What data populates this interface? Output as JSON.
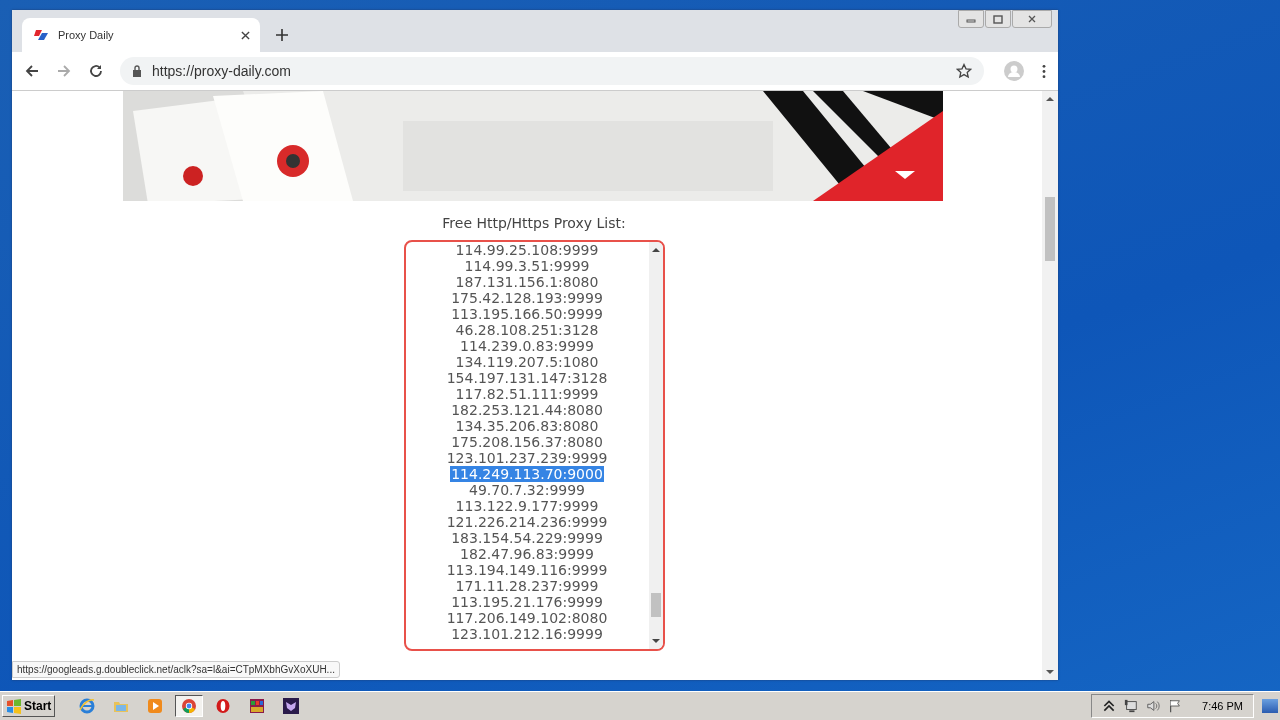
{
  "browser": {
    "tab_title": "Proxy Daily",
    "url": "https://proxy-daily.com",
    "status_url": "https://googleads.g.doubleclick.net/aclk?sa=l&ai=CTpMXbhGvXoXUH..."
  },
  "page": {
    "heading": "Free Http/Https Proxy List:",
    "proxies": [
      {
        "text": "114.99.25.108:9999",
        "selected": false
      },
      {
        "text": "114.99.3.51:9999",
        "selected": false
      },
      {
        "text": "187.131.156.1:8080",
        "selected": false
      },
      {
        "text": "175.42.128.193:9999",
        "selected": false
      },
      {
        "text": "113.195.166.50:9999",
        "selected": false
      },
      {
        "text": "46.28.108.251:3128",
        "selected": false
      },
      {
        "text": "114.239.0.83:9999",
        "selected": false
      },
      {
        "text": "134.119.207.5:1080",
        "selected": false
      },
      {
        "text": "154.197.131.147:3128",
        "selected": false
      },
      {
        "text": "117.82.51.111:9999",
        "selected": false
      },
      {
        "text": "182.253.121.44:8080",
        "selected": false
      },
      {
        "text": "134.35.206.83:8080",
        "selected": false
      },
      {
        "text": "175.208.156.37:8080",
        "selected": false
      },
      {
        "text": "123.101.237.239:9999",
        "selected": false
      },
      {
        "text": "114.249.113.70:9000",
        "selected": true
      },
      {
        "text": "49.70.7.32:9999",
        "selected": false
      },
      {
        "text": "113.122.9.177:9999",
        "selected": false
      },
      {
        "text": "121.226.214.236:9999",
        "selected": false
      },
      {
        "text": "183.154.54.229:9999",
        "selected": false
      },
      {
        "text": "182.47.96.83:9999",
        "selected": false
      },
      {
        "text": "113.194.149.116:9999",
        "selected": false
      },
      {
        "text": "171.11.28.237:9999",
        "selected": false
      },
      {
        "text": "113.195.21.176:9999",
        "selected": false
      },
      {
        "text": "117.206.149.102:8080",
        "selected": false
      },
      {
        "text": "123.101.212.16:9999",
        "selected": false
      }
    ]
  },
  "taskbar": {
    "start": "Start",
    "apps": [
      {
        "kind": "ie",
        "selected": false
      },
      {
        "kind": "folder",
        "selected": false
      },
      {
        "kind": "media",
        "selected": false
      },
      {
        "kind": "chrome",
        "selected": true
      },
      {
        "kind": "opera",
        "selected": false
      },
      {
        "kind": "archive",
        "selected": false
      },
      {
        "kind": "shield",
        "selected": false
      }
    ],
    "clock": "7:46 PM"
  }
}
